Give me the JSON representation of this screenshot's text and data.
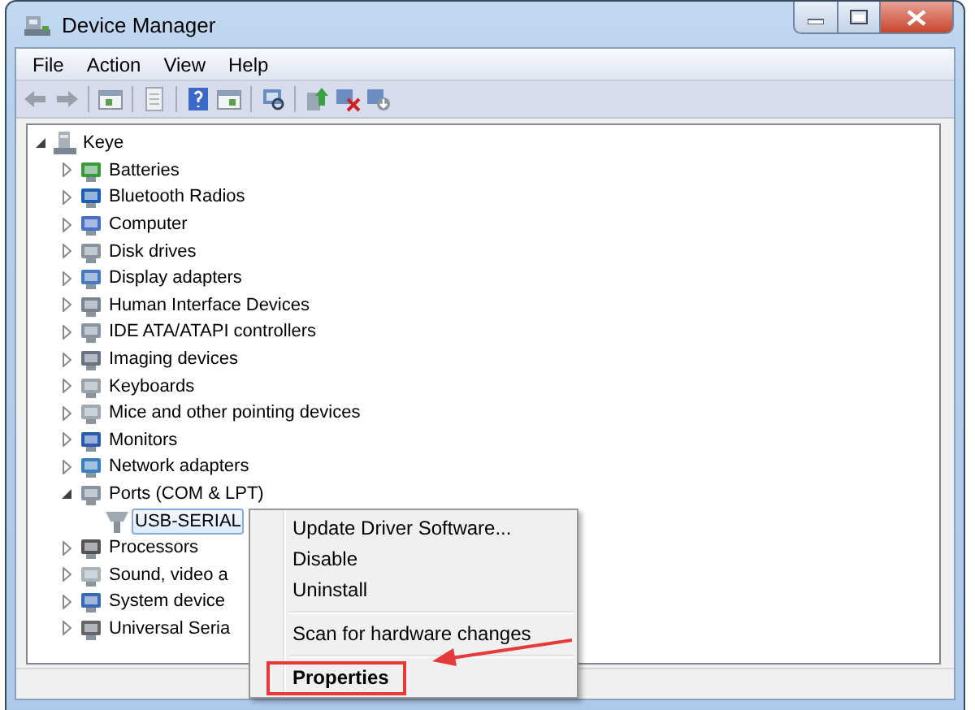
{
  "window": {
    "title": "Device Manager"
  },
  "menu_bar": [
    "File",
    "Action",
    "View",
    "Help"
  ],
  "tree": [
    {
      "label": "Keye",
      "expanded": true,
      "selected": false,
      "children": [
        {
          "label": "Batteries",
          "expanded": false,
          "selected": false
        },
        {
          "label": "Bluetooth Radios",
          "expanded": false,
          "selected": false
        },
        {
          "label": "Computer",
          "expanded": false,
          "selected": false
        },
        {
          "label": "Disk drives",
          "expanded": false,
          "selected": false
        },
        {
          "label": "Display adapters",
          "expanded": false,
          "selected": false
        },
        {
          "label": "Human Interface Devices",
          "expanded": false,
          "selected": false
        },
        {
          "label": "IDE ATA/ATAPI controllers",
          "expanded": false,
          "selected": false
        },
        {
          "label": "Imaging devices",
          "expanded": false,
          "selected": false
        },
        {
          "label": "Keyboards",
          "expanded": false,
          "selected": false
        },
        {
          "label": "Mice and other pointing devices",
          "expanded": false,
          "selected": false
        },
        {
          "label": "Monitors",
          "expanded": false,
          "selected": false
        },
        {
          "label": "Network adapters",
          "expanded": false,
          "selected": false
        },
        {
          "label": "Ports (COM & LPT)",
          "expanded": true,
          "selected": false,
          "children": [
            {
              "label": "USB-SERIAL",
              "selected": true
            }
          ]
        },
        {
          "label": "Processors",
          "expanded": false,
          "selected": false
        },
        {
          "label": "Sound, video a",
          "expanded": false,
          "selected": false
        },
        {
          "label": "System device",
          "expanded": false,
          "selected": false
        },
        {
          "label": "Universal Seria",
          "expanded": false,
          "selected": false
        }
      ]
    }
  ],
  "context_menu": {
    "groups": [
      [
        {
          "label": "Update Driver Software...",
          "default": false,
          "highlighted": false
        },
        {
          "label": "Disable",
          "default": false,
          "highlighted": false
        },
        {
          "label": "Uninstall",
          "default": false,
          "highlighted": false
        }
      ],
      [
        {
          "label": "Scan for hardware changes",
          "default": false,
          "highlighted": false
        }
      ],
      [
        {
          "label": "Properties",
          "default": true,
          "highlighted": true
        }
      ]
    ]
  }
}
